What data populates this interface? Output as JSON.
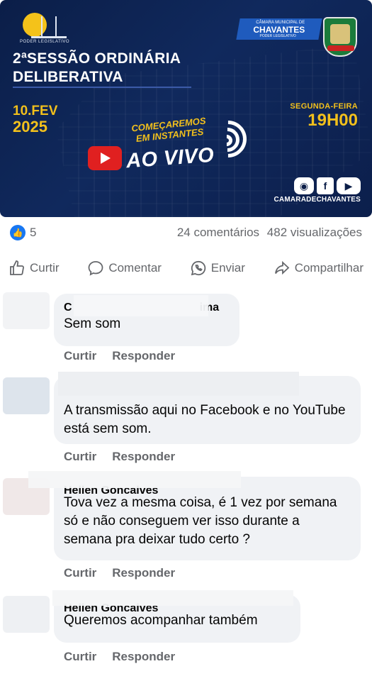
{
  "banner": {
    "logo_caption": "PODER LEGISLATIVO",
    "title_line1": "2ªSESSÃO ORDINÁRIA",
    "title_line2": "DELIBERATIVA",
    "date_line1": "10.FEV",
    "date_line2": "2025",
    "council_top": "CÂMARA MUNICIPAL DE",
    "council_name": "CHAVANTES",
    "council_sub": "PODER LEGISLATIVO",
    "weekday": "SEGUNDA-FEIRA",
    "time": "19H00",
    "soon_line1": "COMEÇAREMOS",
    "soon_line2": "EM INSTANTES",
    "live_label": "AO VIVO",
    "social_fb": "f",
    "handle": "CAMARADECHAVANTES"
  },
  "stats": {
    "reactions": "5",
    "comments": "24 comentários",
    "views": "482 visualizações"
  },
  "actions": {
    "like": "Curtir",
    "comment": "Comentar",
    "send": "Enviar",
    "share": "Compartilhar"
  },
  "comments": [
    {
      "name_start": "C",
      "name_end": "ima",
      "text": "Sem som",
      "like": "Curtir",
      "reply": "Responder"
    },
    {
      "text": "A transmissão aqui no Facebook e no YouTube está sem som.",
      "like": "Curtir",
      "reply": "Responder"
    },
    {
      "name": "Hellen Gonçalves",
      "text": "Tova vez a mesma coisa, é 1 vez por semana só e não conseguem ver isso durante a semana pra deixar tudo certo ?",
      "like": "Curtir",
      "reply": "Responder"
    },
    {
      "name": "Hellen Gonçalves",
      "text": "Queremos acompanhar também",
      "like": "Curtir",
      "reply": "Responder"
    }
  ],
  "colors": {
    "accent": "#1877f2",
    "banner_bg": "#10295d",
    "gold": "#f2c01c",
    "muted": "#65676b",
    "bubble": "#f0f2f5"
  }
}
